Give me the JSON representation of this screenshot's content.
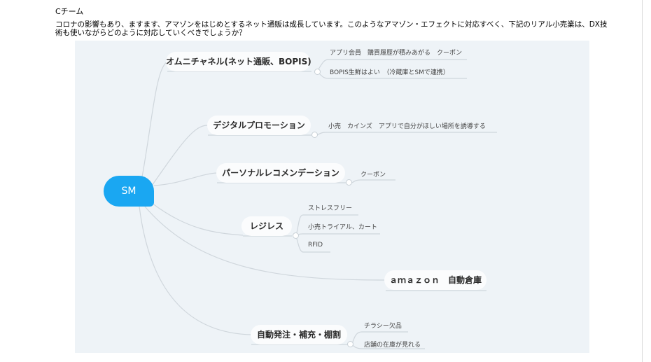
{
  "header": {
    "team": "Cチーム",
    "question": "コロナの影響もあり、ますます、アマゾンをはじめとするネット通販は成長しています。このようなアマゾン・エフェクトに対応すべく、下記のリアル小売業は、DX技術も使いながらどのように対応していくべきでしょうか？"
  },
  "mindmap": {
    "root": "SM",
    "branches": {
      "omni": {
        "label": "オムニチャネル(ネット通販、BOPIS)",
        "leaves": [
          "アプリ会員　購買履歴が積みあがる　クーポン",
          "BOPIS生鮮はよい　（冷蔵庫とSMで連携）"
        ]
      },
      "promo": {
        "label": "デジタルプロモーション",
        "leaves": [
          "小売　カインズ　アプリで自分がほしい場所を誘導する"
        ]
      },
      "recommend": {
        "label": "パーソナルレコメンデーション",
        "leaves": [
          "クーポン"
        ]
      },
      "registerless": {
        "label": "レジレス",
        "leaves": [
          "ストレスフリー",
          "小売トライアル、カート",
          "RFID"
        ]
      },
      "amazon": {
        "label": "ａｍａｚｏｎ　自動倉庫",
        "leaves": []
      },
      "auto_order": {
        "label": "自動発注・補充・棚割",
        "leaves": [
          "チラシー欠品",
          "店舗の在庫が見れる"
        ]
      }
    }
  }
}
